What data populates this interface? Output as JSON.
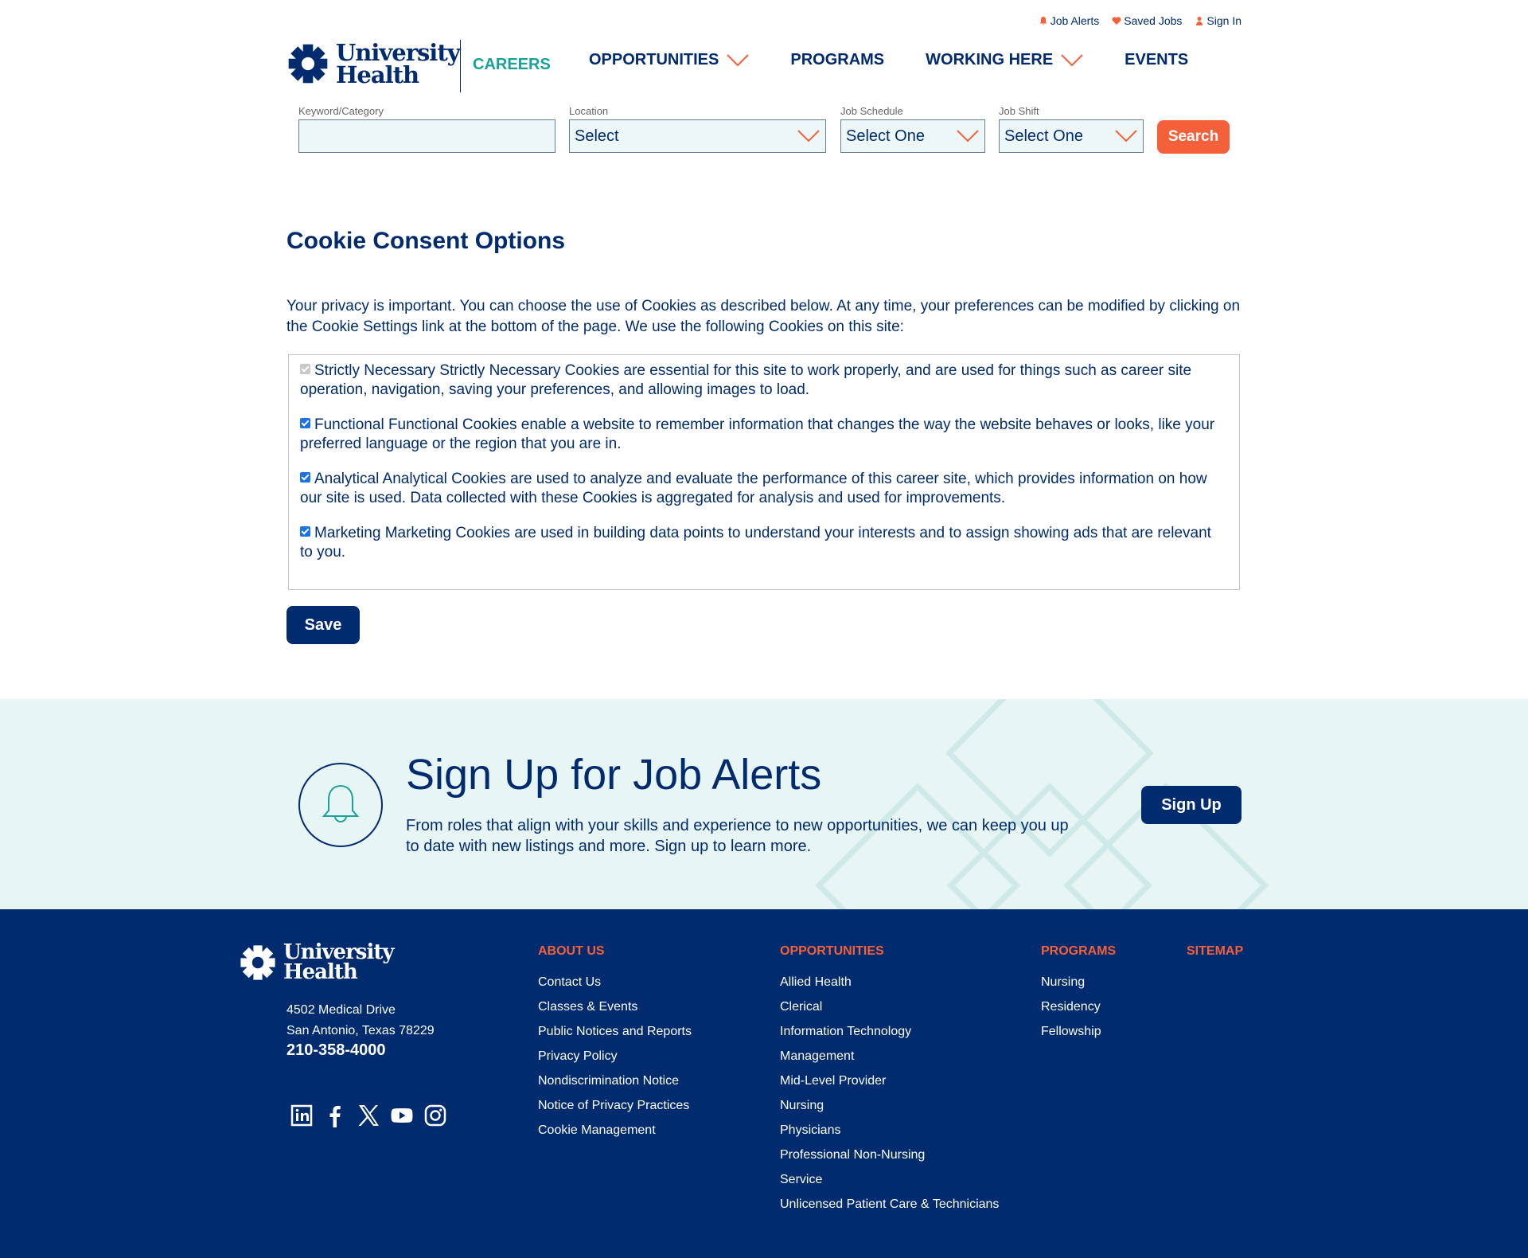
{
  "utility": {
    "job_alerts": "Job Alerts",
    "saved_jobs": "Saved Jobs",
    "sign_in": "Sign In"
  },
  "brand": {
    "name_line1": "University",
    "name_line2": "Health",
    "careers": "CAREERS",
    "navy": "#002b6e",
    "orange": "#f4603a",
    "teal": "#1aa19a"
  },
  "nav": {
    "opportunities": "OPPORTUNITIES",
    "programs": "PROGRAMS",
    "working_here": "WORKING HERE",
    "events": "EVENTS"
  },
  "search": {
    "keyword_label": "Keyword/Category",
    "keyword_value": "",
    "location_label": "Location",
    "location_value": "Select",
    "schedule_label": "Job Schedule",
    "schedule_value": "Select One",
    "shift_label": "Job Shift",
    "shift_value": "Select One",
    "button": "Search"
  },
  "cookies": {
    "title": "Cookie Consent Options",
    "intro": "Your privacy is important. You can choose the use of Cookies as described below. At any time, your preferences can be modified by clicking on the Cookie Settings link at the bottom of the page. We use the following Cookies on this site:",
    "options": [
      {
        "text": "Strictly Necessary Strictly Necessary Cookies are essential for this site to work properly, and are used for things such as career site operation, navigation, saving your preferences, and allowing images to load.",
        "checked": true,
        "disabled": true
      },
      {
        "text": "Functional Functional Cookies enable a website to remember information that changes the way the website behaves or looks, like your preferred language or the region that you are in.",
        "checked": true,
        "disabled": false
      },
      {
        "text": "Analytical Analytical Cookies are used to analyze and evaluate the performance of this career site, which provides information on how our site is used. Data collected with these Cookies is aggregated for analysis and used for improvements.",
        "checked": true,
        "disabled": false
      },
      {
        "text": "Marketing Marketing Cookies are used in building data points to understand your interests and to assign showing ads that are relevant to you.",
        "checked": true,
        "disabled": false
      }
    ],
    "save": "Save"
  },
  "alerts": {
    "title": "Sign Up for Job Alerts",
    "body": "From roles that align with your skills and experience to new opportunities, we can keep you up to date with new listings and more. Sign up to learn more.",
    "button": "Sign Up"
  },
  "footer": {
    "address1": "4502 Medical Drive",
    "address2": "San Antonio, Texas 78229",
    "phone": "210-358-4000",
    "social_icons": [
      "linkedin-icon",
      "facebook-icon",
      "x-icon",
      "youtube-icon",
      "instagram-icon"
    ],
    "about": {
      "heading": "ABOUT US",
      "links": [
        "Contact Us",
        "Classes & Events",
        "Public Notices and Reports",
        "Privacy Policy",
        "Nondiscrimination Notice",
        "Notice of Privacy Practices",
        "Cookie Management"
      ]
    },
    "opportunities": {
      "heading": "OPPORTUNITIES",
      "links": [
        "Allied Health",
        "Clerical",
        "Information Technology",
        "Management",
        "Mid-Level Provider",
        "Nursing",
        "Physicians",
        "Professional Non-Nursing",
        "Service",
        "Unlicensed Patient Care & Technicians"
      ]
    },
    "programs": {
      "heading": "PROGRAMS",
      "links": [
        "Nursing",
        "Residency",
        "Fellowship"
      ]
    },
    "sitemap": {
      "heading": "SITEMAP"
    }
  }
}
